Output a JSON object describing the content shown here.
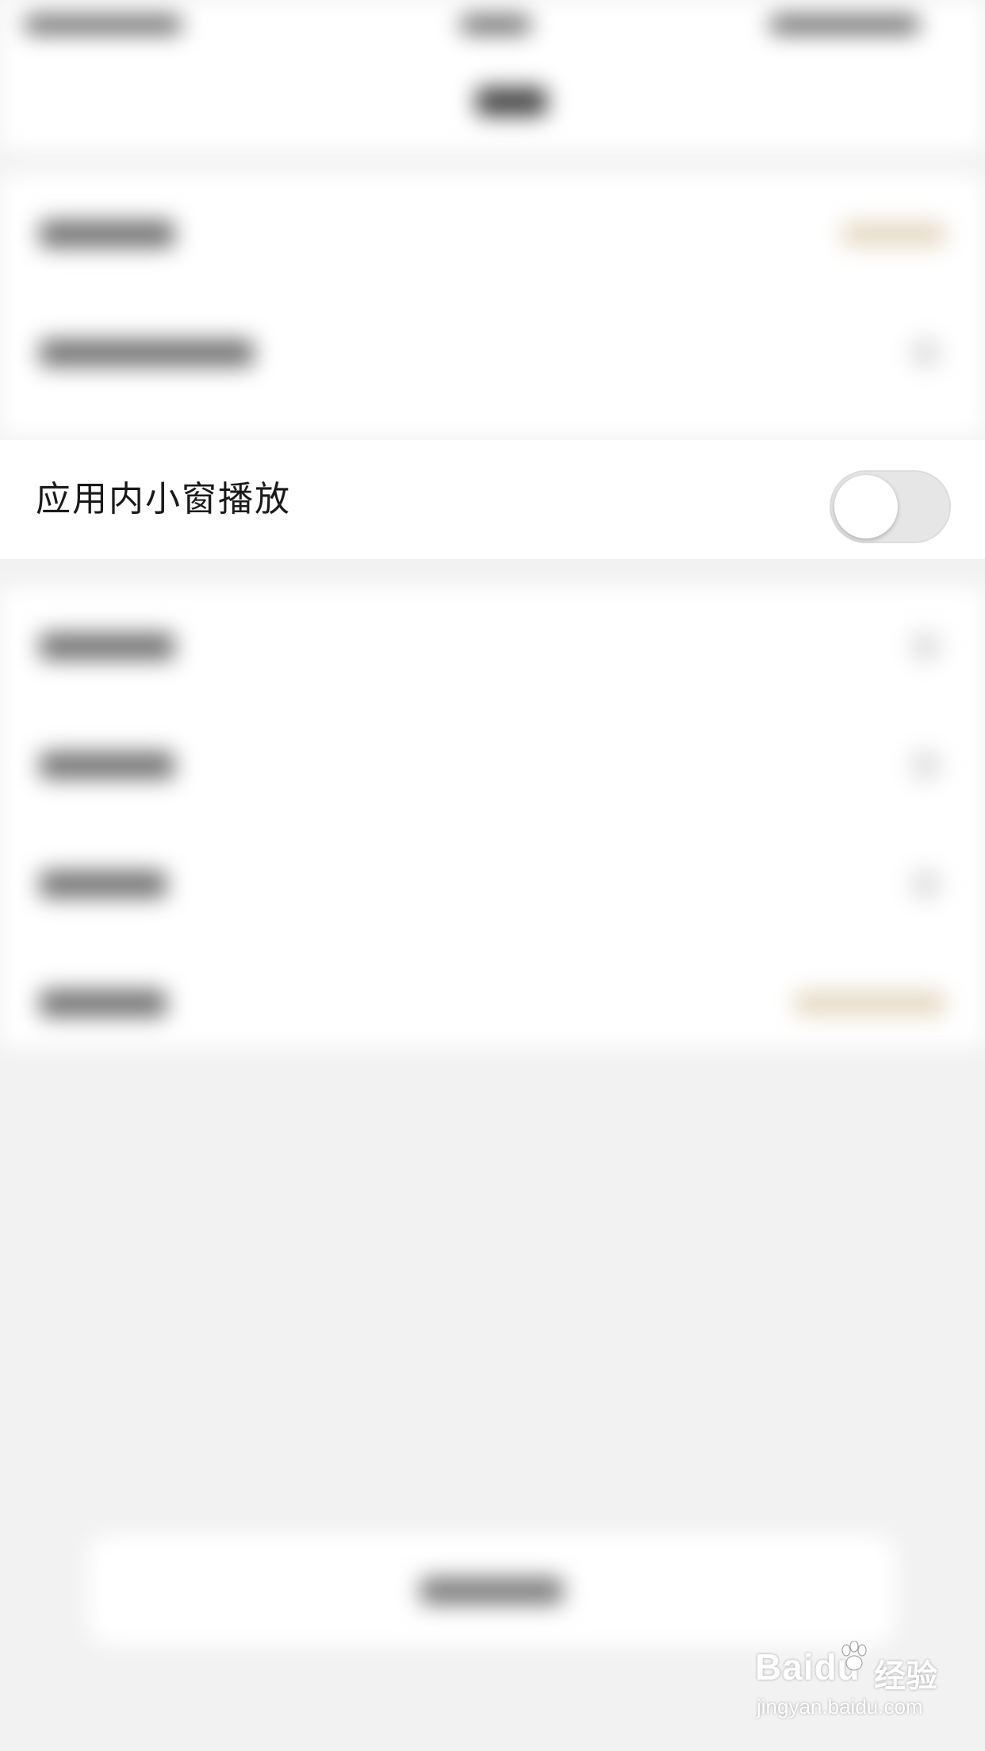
{
  "setting_row": {
    "label": "应用内小窗播放",
    "toggle_on": false
  },
  "colors": {
    "background": "#f2f2f2",
    "row_background": "#ffffff",
    "toggle_track_off": "#e6e6e6",
    "toggle_knob": "#ffffff",
    "label_text": "#1a1a1a"
  },
  "watermark": {
    "logo_text": "Baidu",
    "product_text": "经验",
    "url_text": "jingyan.baidu.com",
    "icon": "paw-icon"
  }
}
